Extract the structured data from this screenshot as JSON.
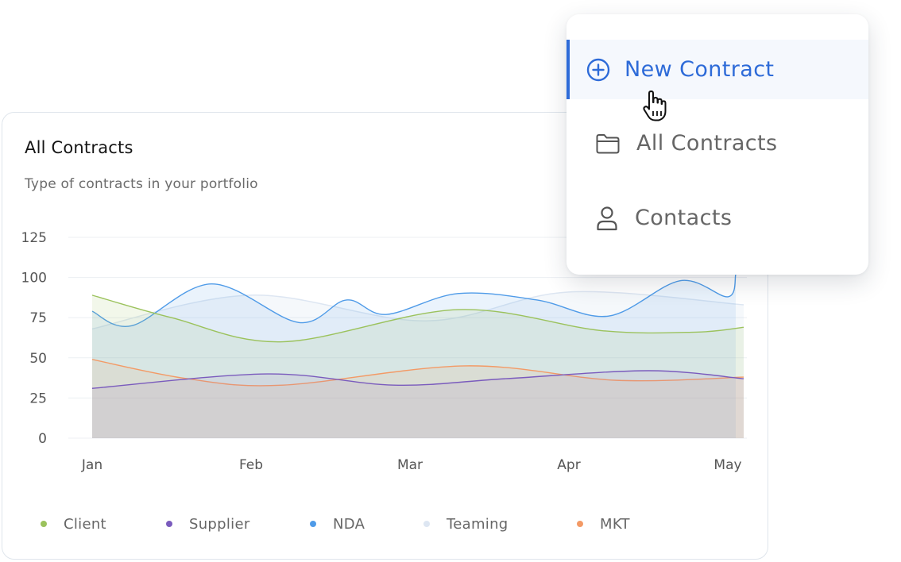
{
  "card": {
    "title": "All Contracts",
    "subtitle": "Type of contracts in your portfolio"
  },
  "menu": {
    "items": [
      {
        "label": "New Contract",
        "icon": "plus-circle-icon",
        "active": true
      },
      {
        "label": "All Contracts",
        "icon": "folder-icon",
        "active": false
      },
      {
        "label": "Contacts",
        "icon": "user-icon",
        "active": false
      }
    ],
    "accent_color": "#2e6bd8",
    "text_color": "#666666"
  },
  "chart_data": {
    "type": "area",
    "x": [
      "Jan",
      "Feb",
      "Mar",
      "Apr",
      "May"
    ],
    "ylim": [
      0,
      125
    ],
    "yticks": [
      125,
      100,
      75,
      50,
      25,
      0
    ],
    "grid": true,
    "legend_position": "bottom",
    "series": [
      {
        "name": "Client",
        "color": "#9bc25c",
        "x": [
          0,
          0.5,
          1.2,
          2.3,
          3.2,
          3.8,
          4.1
        ],
        "y": [
          89,
          75,
          60,
          80,
          67,
          66,
          69
        ]
      },
      {
        "name": "Supplier",
        "color": "#7a5bbd",
        "x": [
          0,
          1.1,
          1.9,
          2.6,
          3.5,
          4.1
        ],
        "y": [
          31,
          40,
          33,
          37,
          42,
          37
        ]
      },
      {
        "name": "NDA",
        "color": "#4f9be8",
        "x": [
          0,
          0.25,
          0.75,
          1.3,
          1.6,
          1.85,
          2.3,
          2.8,
          3.25,
          3.7,
          4.0,
          4.05
        ],
        "y": [
          79,
          70,
          96,
          72,
          86,
          77,
          90,
          86,
          76,
          98,
          88,
          102
        ]
      },
      {
        "name": "Teaming",
        "color": "#dde6f2",
        "x": [
          0,
          1.0,
          2.1,
          3.0,
          4.1
        ],
        "y": [
          68,
          89,
          73,
          91,
          83
        ]
      },
      {
        "name": "MKT",
        "color": "#f39a66",
        "x": [
          0,
          0.6,
          1.2,
          2.35,
          3.3,
          4.1
        ],
        "y": [
          49,
          37,
          33,
          45,
          36,
          38
        ]
      }
    ]
  }
}
